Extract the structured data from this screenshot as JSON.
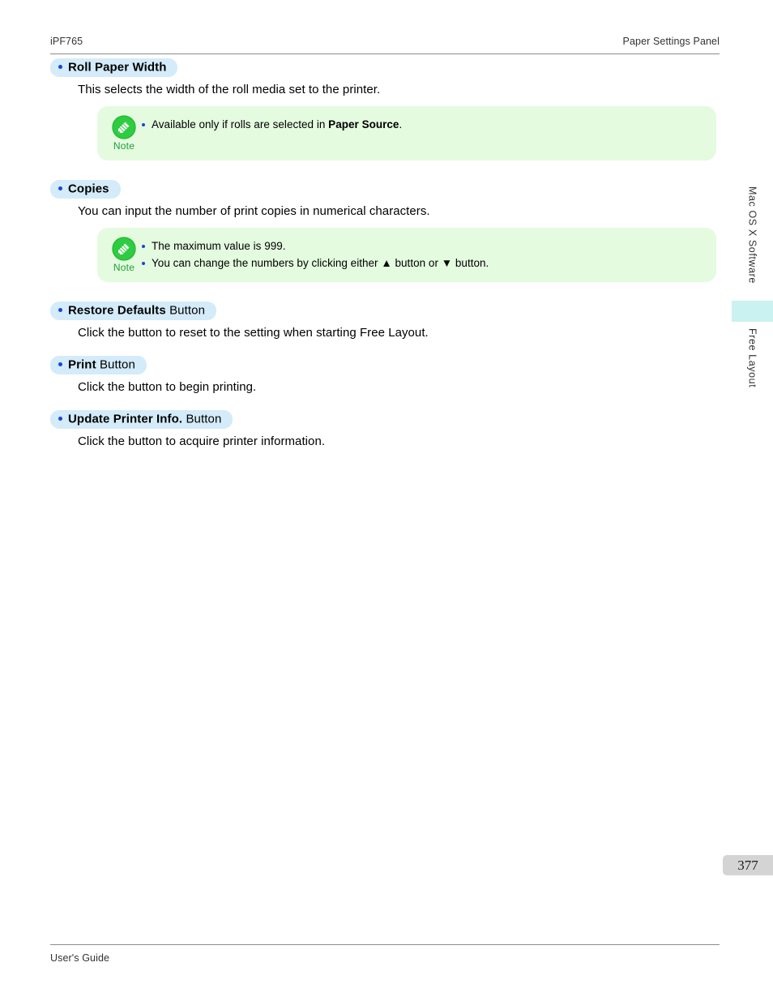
{
  "header": {
    "left": "iPF765",
    "right": "Paper Settings Panel"
  },
  "footer": {
    "text": "User's Guide"
  },
  "page_number": "377",
  "side_tabs": {
    "upper_label": "Mac OS X Software",
    "lower_label": "Free Layout",
    "highlight_color": "#c9f2f0"
  },
  "colors": {
    "pill_background": "#d4ebf9",
    "bullet_blue": "#1a46d6",
    "note_background": "#e4fbe0",
    "note_label_green": "#1e9e35",
    "page_number_background": "#d4d4d4"
  },
  "note_label": "Note",
  "sections": [
    {
      "term": "Roll Paper Width",
      "suffix": "",
      "body": "This selects the width of the roll media set to the printer.",
      "note_items": [
        {
          "lead": "Available only if rolls are selected in ",
          "bold": "Paper Source",
          "tail": "."
        }
      ]
    },
    {
      "term": "Copies",
      "suffix": "",
      "body": "You can input the number of print copies in numerical characters.",
      "note_items": [
        {
          "lead": "The maximum value is 999.",
          "bold": "",
          "tail": ""
        },
        {
          "lead": "You can change the numbers by clicking either ▲ button or ▼ button.",
          "bold": "",
          "tail": ""
        }
      ]
    },
    {
      "term": "Restore Defaults",
      "suffix": " Button",
      "body": "Click the button to reset to the setting when starting Free Layout.",
      "note_items": []
    },
    {
      "term": "Print",
      "suffix": " Button",
      "body": "Click the button to begin printing.",
      "note_items": []
    },
    {
      "term": "Update Printer Info.",
      "suffix": " Button",
      "body": "Click the button to acquire printer information.",
      "note_items": []
    }
  ]
}
